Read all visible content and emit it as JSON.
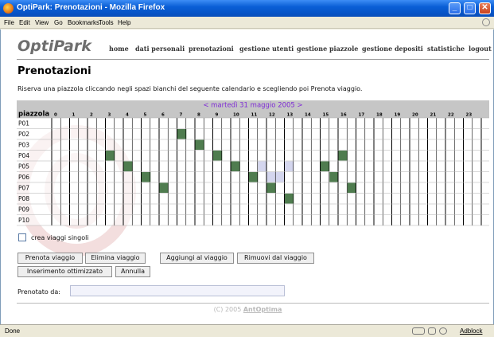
{
  "window": {
    "title": "OptiPark: Prenotazioni - Mozilla Firefox"
  },
  "menu": [
    "File",
    "Edit",
    "View",
    "Go",
    "Bookmarks",
    "Tools",
    "Help"
  ],
  "site": {
    "logo": "OptiPark",
    "nav": [
      "home",
      "dati personali",
      "prenotazioni",
      "gestione utenti",
      "gestione piazzole",
      "gestione depositi",
      "statistiche",
      "logout"
    ]
  },
  "page": {
    "title": "Prenotazioni",
    "description": "Riserva una piazzola cliccando negli spazi bianchi del seguente calendario e scegliendo poi Prenota viaggio."
  },
  "calendar": {
    "date_label": "< martedì 31 maggio 2005 >",
    "first_col_header": "piazzola",
    "hours": [
      "0",
      "1",
      "2",
      "3",
      "4",
      "5",
      "6",
      "7",
      "8",
      "9",
      "10",
      "11",
      "12",
      "13",
      "14",
      "15",
      "16",
      "17",
      "18",
      "19",
      "20",
      "21",
      "22",
      "23"
    ],
    "spots": [
      "P01",
      "P02",
      "P03",
      "P04",
      "P05",
      "P06",
      "P07",
      "P08",
      "P09",
      "P10"
    ],
    "colors": {
      "header_bg": "#c6c6c6",
      "booked": "#4f7c4f",
      "selected": "#d4d6ee",
      "date": "#7f2cd6"
    },
    "booked": [
      [
        "P02",
        7
      ],
      [
        "P03",
        8
      ],
      [
        "P04",
        3
      ],
      [
        "P04",
        9
      ],
      [
        "P04",
        16
      ],
      [
        "P05",
        4
      ],
      [
        "P05",
        10
      ],
      [
        "P05",
        15
      ],
      [
        "P06",
        5
      ],
      [
        "P06",
        11
      ],
      [
        "P06",
        15.5
      ],
      [
        "P07",
        6
      ],
      [
        "P07",
        12
      ],
      [
        "P07",
        16.5
      ],
      [
        "P08",
        13
      ]
    ],
    "selected": [
      [
        "P05",
        11.5
      ],
      [
        "P05",
        13
      ],
      [
        "P06",
        12
      ],
      [
        "P06",
        12.5
      ]
    ]
  },
  "options": {
    "single_trips_label": "crea viaggi singoli"
  },
  "buttons": {
    "prenota": "Prenota viaggio",
    "elimina": "Elimina viaggio",
    "aggiungi": "Aggiungi al viaggio",
    "rimuovi": "Rimuovi dal viaggio",
    "inserimento": "Inserimento ottimizzato",
    "annulla": "Annulla"
  },
  "booked_by": {
    "label": "Prenotato da:",
    "value": ""
  },
  "footer": {
    "copyright": "(C) 2005",
    "company": "AntOptima"
  },
  "status": {
    "text": "Done",
    "adblock": "Adblock"
  }
}
